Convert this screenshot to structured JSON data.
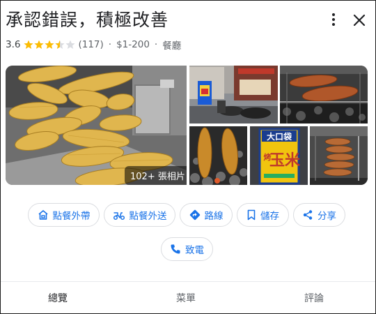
{
  "place": {
    "name": "承認錯誤，積極改善",
    "rating": "3.6",
    "rating_value": 3.6,
    "reviews": "(117)",
    "separator": "·",
    "price": "$1-200",
    "category": "餐廳"
  },
  "gallery": {
    "photo_count": "102+ 張相片",
    "sign_text": "大口袋",
    "sign_main": "玉米",
    "sign_sub": "烤"
  },
  "actions": {
    "takeout": "點餐外帶",
    "delivery": "點餐外送",
    "directions": "路線",
    "save": "儲存",
    "share": "分享",
    "call": "致電"
  },
  "tabs": {
    "overview": "總覽",
    "menu": "菜單",
    "reviews": "評論"
  },
  "icons": {
    "more": "more-vert-icon",
    "close": "close-icon",
    "takeout": "takeout-bag-icon",
    "delivery": "delivery-scooter-icon",
    "directions": "directions-diamond-icon",
    "save": "bookmark-icon",
    "share": "share-icon",
    "call": "phone-icon"
  },
  "colors": {
    "accent": "#1a73e8",
    "star": "#fbbc04",
    "star_empty": "#dadce0",
    "text": "#202124",
    "muted": "#5f6368"
  }
}
